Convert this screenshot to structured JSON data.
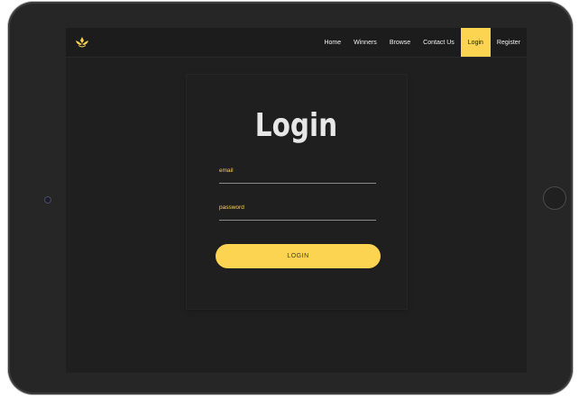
{
  "navbar": {
    "links": [
      {
        "label": "Home",
        "active": false
      },
      {
        "label": "Winners",
        "active": false
      },
      {
        "label": "Browse",
        "active": false
      },
      {
        "label": "Contact Us",
        "active": false
      },
      {
        "label": "Login",
        "active": true
      },
      {
        "label": "Register",
        "active": false
      }
    ],
    "logo_icon": "lotus-icon"
  },
  "login": {
    "title": "Login",
    "email_placeholder": "email",
    "password_placeholder": "password",
    "button_label": "LOGIN"
  },
  "colors": {
    "accent": "#fcd451",
    "background": "#1f1f1f",
    "text": "#e7e7e7"
  }
}
